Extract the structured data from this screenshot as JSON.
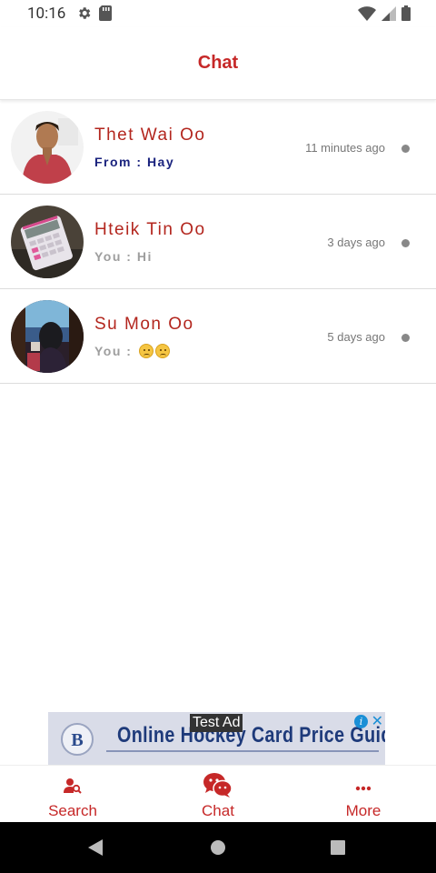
{
  "status_bar": {
    "time": "10:16"
  },
  "app_bar": {
    "title": "Chat"
  },
  "chats": [
    {
      "name": "Thet Wai Oo",
      "preview": "From : Hay",
      "time": "11 minutes ago"
    },
    {
      "name": "Hteik Tin Oo",
      "preview": "You : Hi",
      "time": "3 days ago"
    },
    {
      "name": "Su Mon Oo",
      "preview": "You :",
      "time": "5 days ago"
    }
  ],
  "ad": {
    "label": "Test Ad",
    "text": "Online Hockey Card Price Guide",
    "info": "i",
    "close": "✕"
  },
  "nav": {
    "search": "Search",
    "chat": "Chat",
    "more": "More"
  },
  "colors": {
    "accent": "#c62828",
    "preview_from": "#1a237e"
  }
}
